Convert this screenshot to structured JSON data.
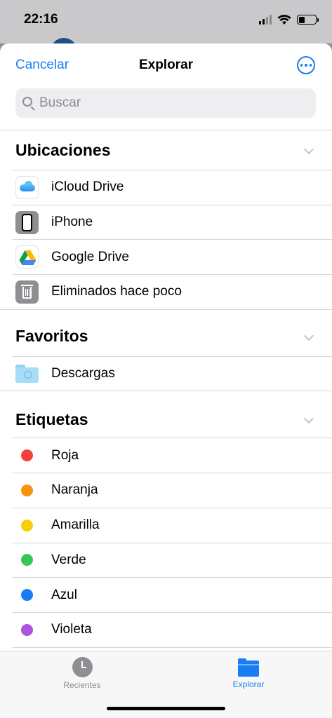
{
  "status_bar": {
    "time": "22:16"
  },
  "nav": {
    "cancel_label": "Cancelar",
    "title": "Explorar",
    "more_icon": "ellipsis-circle-icon"
  },
  "search": {
    "placeholder": "Buscar",
    "value": ""
  },
  "sections": {
    "locations": {
      "title": "Ubicaciones",
      "items": [
        {
          "label": "iCloud Drive",
          "icon": "icloud-icon"
        },
        {
          "label": "iPhone",
          "icon": "iphone-icon"
        },
        {
          "label": "Google Drive",
          "icon": "google-drive-icon"
        },
        {
          "label": "Eliminados hace poco",
          "icon": "trash-icon"
        }
      ]
    },
    "favorites": {
      "title": "Favoritos",
      "items": [
        {
          "label": "Descargas",
          "icon": "downloads-folder-icon"
        }
      ]
    },
    "tags": {
      "title": "Etiquetas",
      "items": [
        {
          "label": "Roja",
          "color": "#f2413b"
        },
        {
          "label": "Naranja",
          "color": "#f7930e"
        },
        {
          "label": "Amarilla",
          "color": "#f9cd09"
        },
        {
          "label": "Verde",
          "color": "#37c759"
        },
        {
          "label": "Azul",
          "color": "#1a7cf5"
        },
        {
          "label": "Violeta",
          "color": "#af52de"
        }
      ]
    }
  },
  "tabbar": {
    "tabs": [
      {
        "label": "Recientes",
        "icon": "clock-icon",
        "selected": false
      },
      {
        "label": "Explorar",
        "icon": "folder-icon",
        "selected": true
      }
    ]
  },
  "colors": {
    "accent": "#1a7cf5",
    "secondary_text": "#8e8e93"
  }
}
